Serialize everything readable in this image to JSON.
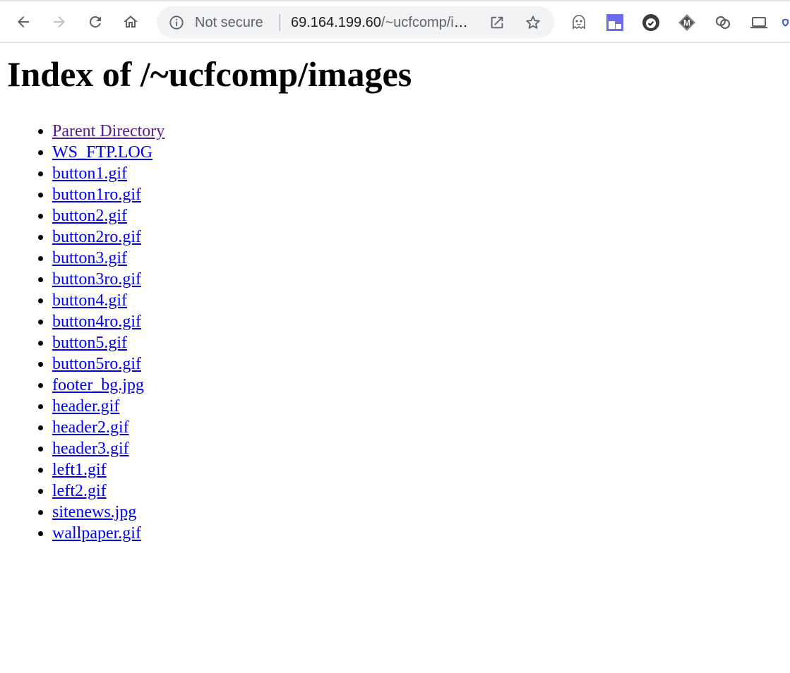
{
  "browser": {
    "security_label": "Not secure",
    "url_host": "69.164.199.60",
    "url_path": "/~ucfcomp/images",
    "colors": {
      "omnibox_bg": "#f1f3f4",
      "icon": "#5f6368",
      "link": "#0000ee",
      "visited_link": "#551a8b"
    },
    "icons": {
      "back": "back-arrow-icon",
      "forward": "forward-arrow-icon",
      "reload": "reload-icon",
      "home": "home-icon",
      "info": "info-icon",
      "open_in_app": "open-external-icon",
      "bookmark": "star-icon"
    },
    "extensions": [
      "ghost-extension-icon",
      "window-extension-icon",
      "check-badge-extension-icon",
      "m-diamond-extension-icon",
      "rings-extension-icon",
      "laptop-extension-icon",
      "shield-extension-icon"
    ]
  },
  "page": {
    "title": "Index of /~ucfcomp/images",
    "items": [
      {
        "label": "Parent Directory",
        "visited": true
      },
      {
        "label": "WS_FTP.LOG",
        "visited": false
      },
      {
        "label": "button1.gif",
        "visited": false
      },
      {
        "label": "button1ro.gif",
        "visited": false
      },
      {
        "label": "button2.gif",
        "visited": false
      },
      {
        "label": "button2ro.gif",
        "visited": false
      },
      {
        "label": "button3.gif",
        "visited": false
      },
      {
        "label": "button3ro.gif",
        "visited": false
      },
      {
        "label": "button4.gif",
        "visited": false
      },
      {
        "label": "button4ro.gif",
        "visited": false
      },
      {
        "label": "button5.gif",
        "visited": false
      },
      {
        "label": "button5ro.gif",
        "visited": false
      },
      {
        "label": "footer_bg.jpg",
        "visited": false
      },
      {
        "label": "header.gif",
        "visited": false
      },
      {
        "label": "header2.gif",
        "visited": false
      },
      {
        "label": "header3.gif",
        "visited": false
      },
      {
        "label": "left1.gif",
        "visited": false
      },
      {
        "label": "left2.gif",
        "visited": false
      },
      {
        "label": "sitenews.jpg",
        "visited": false
      },
      {
        "label": "wallpaper.gif",
        "visited": false
      }
    ]
  }
}
